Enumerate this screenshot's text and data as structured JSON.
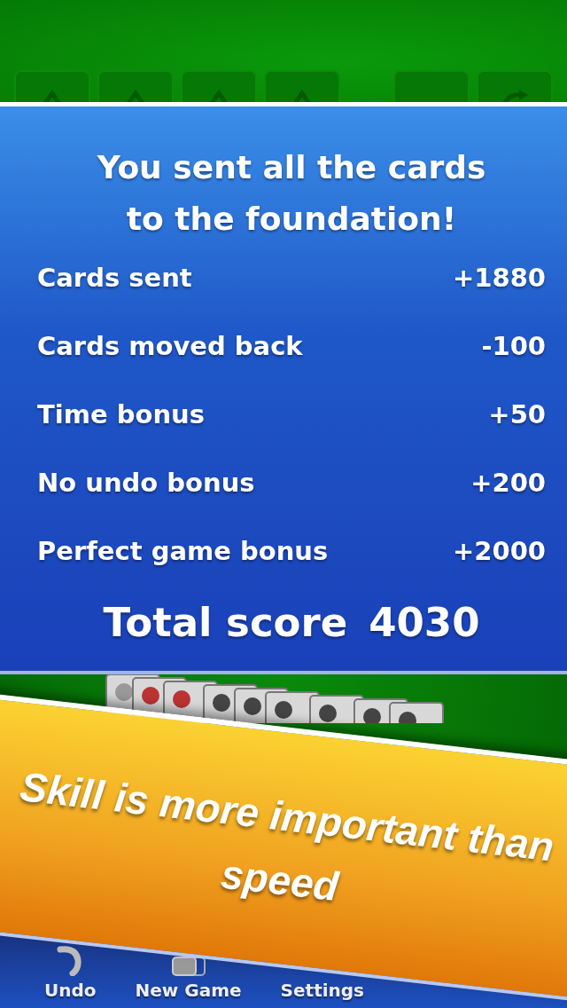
{
  "results": {
    "title": "You sent all the cards to the foundation!",
    "rows": [
      {
        "label": "Cards sent",
        "value": "+1880"
      },
      {
        "label": "Cards moved back",
        "value": "-100"
      },
      {
        "label": "Time bonus",
        "value": "+50"
      },
      {
        "label": "No undo bonus",
        "value": "+200"
      },
      {
        "label": "Perfect game bonus",
        "value": "+2000"
      }
    ],
    "total_label": "Total score",
    "total_value": "4030"
  },
  "banner": {
    "text": "Skill is more important than speed"
  },
  "toolbar": [
    {
      "kind": "undo",
      "label": "Undo"
    },
    {
      "kind": "new",
      "label": "New Game"
    },
    {
      "kind": "settings",
      "label": "Settings"
    }
  ]
}
